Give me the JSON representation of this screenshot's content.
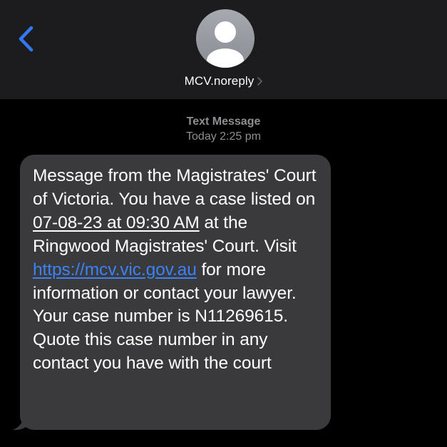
{
  "header": {
    "contact_name": "MCV.noreply",
    "icons": {
      "back": "chevron-left-icon",
      "avatar": "person-icon",
      "details": "chevron-right-icon"
    }
  },
  "meta": {
    "kind": "Text Message",
    "time": "Today 2:25 pm"
  },
  "message": {
    "part1": "Message from the Magistrates' Court of Victoria. You have a case listed on ",
    "date_time": "07-08-23 at 09:30 AM",
    "part2": " at the Ringwood Magistrates' Court. Visit ",
    "url": "https://mcv.vic.gov.au",
    "part3": " for more information or contact your lawyer. Your case number is N11269615. Quote this case number in any contact you have with the court"
  },
  "colors": {
    "background": "#000000",
    "header_bg": "#1c1c1e",
    "bubble_bg": "#3a3a3c",
    "link": "#3b82f6",
    "back_accent": "#3478f6",
    "meta_text": "#8e8e93"
  }
}
